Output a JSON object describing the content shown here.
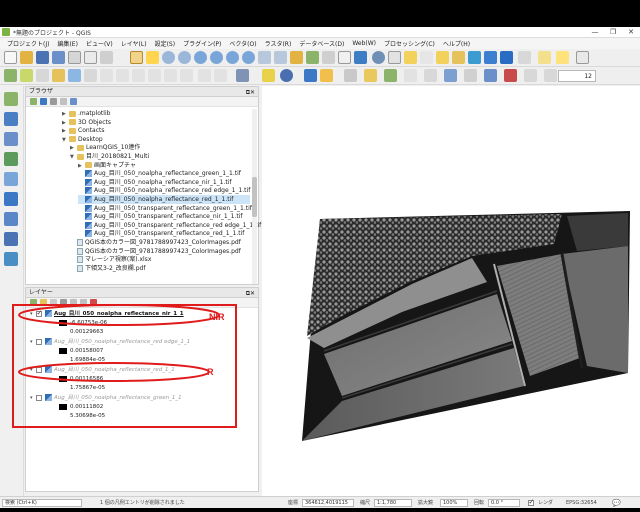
{
  "window": {
    "title": "*無題のプロジェクト - QGIS",
    "controls": [
      "—",
      "❐",
      "✕"
    ]
  },
  "menu": [
    "プロジェクト(J)",
    "編集(E)",
    "ビュー(V)",
    "レイヤ(L)",
    "設定(S)",
    "プラグイン(P)",
    "ベクタ(O)",
    "ラスタ(R)",
    "データベース(D)",
    "Web(W)",
    "プロセッシング(C)",
    "ヘルプ(H)"
  ],
  "toolbar": {
    "opacity_value": "12"
  },
  "browser": {
    "title": "ブラウザ",
    "items": [
      {
        "label": ".matplotlib",
        "type": "folder",
        "arrow": "▶"
      },
      {
        "label": "3D Objects",
        "type": "folder",
        "arrow": "▶"
      },
      {
        "label": "Contacts",
        "type": "folder",
        "arrow": "▶"
      },
      {
        "label": "Desktop",
        "type": "folder",
        "arrow": "▼"
      },
      {
        "label": "LearnQGIS_10連作",
        "type": "folder",
        "arrow": "▶"
      },
      {
        "label": "目川_20180821_Multi",
        "type": "folder",
        "arrow": "▼"
      },
      {
        "label": "画面キャプチャ",
        "type": "folder",
        "arrow": "▶"
      },
      {
        "label": "Aug_目川_050_noalpha_reflectance_green_1_1.tif",
        "type": "raster",
        "arrow": ""
      },
      {
        "label": "Aug_目川_050_noalpha_reflectance_nir_1_1.tif",
        "type": "raster",
        "arrow": ""
      },
      {
        "label": "Aug_目川_050_noalpha_reflectance_red edge_1_1.tif",
        "type": "raster",
        "arrow": ""
      },
      {
        "label": "Aug_目川_050_noalpha_reflectance_red_1_1.tif",
        "type": "raster",
        "arrow": ""
      },
      {
        "label": "Aug_目川_050_transparent_reflectance_green_1_1.tif",
        "type": "raster",
        "arrow": ""
      },
      {
        "label": "Aug_目川_050_transparent_reflectance_nir_1_1.tif",
        "type": "raster",
        "arrow": ""
      },
      {
        "label": "Aug_目川_050_transparent_reflectance_red edge_1_1.tif",
        "type": "raster",
        "arrow": ""
      },
      {
        "label": "Aug_目川_050_transparent_reflectance_red_1_1.tif",
        "type": "raster",
        "arrow": ""
      },
      {
        "label": "QGIS本のカラー図_9781788997423_ColorImages.pdf",
        "type": "file",
        "arrow": ""
      },
      {
        "label": "QGIS本のカラー図_9781788997423_ColorImages.pdf",
        "type": "file",
        "arrow": ""
      },
      {
        "label": "マレーシア視察(案).xlsx",
        "type": "file",
        "arrow": ""
      },
      {
        "label": "下傾又3-2_改良欄.pdf",
        "type": "file",
        "arrow": ""
      }
    ]
  },
  "layers": {
    "title": "レイヤー",
    "items": [
      {
        "name": "Aug_目川_050_noalpha_reflectance_nir_1_1",
        "checked": true,
        "active": true,
        "max": "0.00129663",
        "min": "-6.60753e-06"
      },
      {
        "name": "Aug_目川_050_noalpha_reflectance_red edge_1_1",
        "checked": false,
        "active": false,
        "max": "1.69884e-05",
        "min": "0.00158007"
      },
      {
        "name": "Aug_目川_050_noalpha_reflectance_red_1_1",
        "checked": false,
        "active": false,
        "max": "1.75867e-05",
        "min": "0.00116586"
      },
      {
        "name": "Aug_目川_050_noalpha_reflectance_green_1_1",
        "checked": false,
        "active": false,
        "max": "5.30698e-05",
        "min": "0.00111802"
      }
    ]
  },
  "annotations": {
    "nir": "NIR",
    "r": "R"
  },
  "statusbar": {
    "search_placeholder": "検索 (Ctrl+K)",
    "message": "1 個の凡例エントリが削除されました",
    "coord_label": "座標",
    "coord_value": "364612,4019115",
    "scale_label": "縮尺",
    "scale_value": "1:1,780",
    "magnifier_label": "拡大鏡",
    "magnifier_value": "100%",
    "rotation_label": "回転",
    "rotation_value": "0.0 °",
    "render_label": "レンダ",
    "crs": "EPSG:32654"
  },
  "colors": {
    "annotation": "#e01b1b",
    "selection": "#cce4f7"
  }
}
